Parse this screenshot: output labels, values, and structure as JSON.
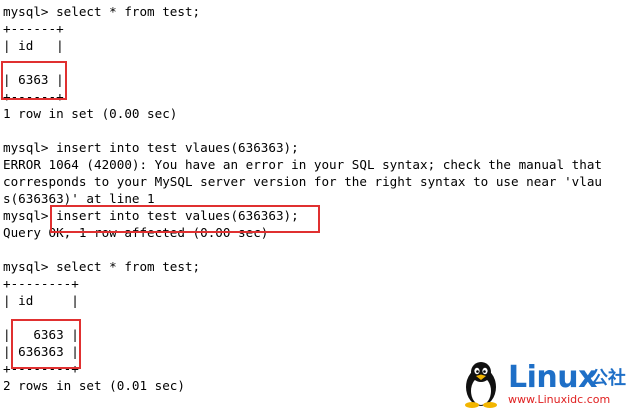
{
  "terminal": {
    "lines": [
      "mysql> select * from test;",
      "+------+",
      "| id   |",
      "",
      "| 6363 |",
      "+------+",
      "1 row in set (0.00 sec)",
      "",
      "mysql> insert into test vlaues(636363);",
      "ERROR 1064 (42000): You have an error in your SQL syntax; check the manual that",
      "corresponds to your MySQL server version for the right syntax to use near 'vlau",
      "s(636363)' at line 1",
      "mysql> insert into test values(636363);",
      "Query OK, 1 row affected (0.00 sec)",
      "",
      "mysql> select * from test;",
      "+--------+",
      "| id     |",
      "",
      "|   6363 |",
      "| 636363 |",
      "+--------+",
      "2 rows in set (0.01 sec)"
    ]
  },
  "colors": {
    "highlight": "#e03030",
    "brand": "#1e6fc7",
    "url": "#e02020"
  },
  "watermark": {
    "brand": "Linux",
    "brand_cn": "公社",
    "url": "www.Linuxidc.com",
    "icon": "penguin-icon"
  }
}
